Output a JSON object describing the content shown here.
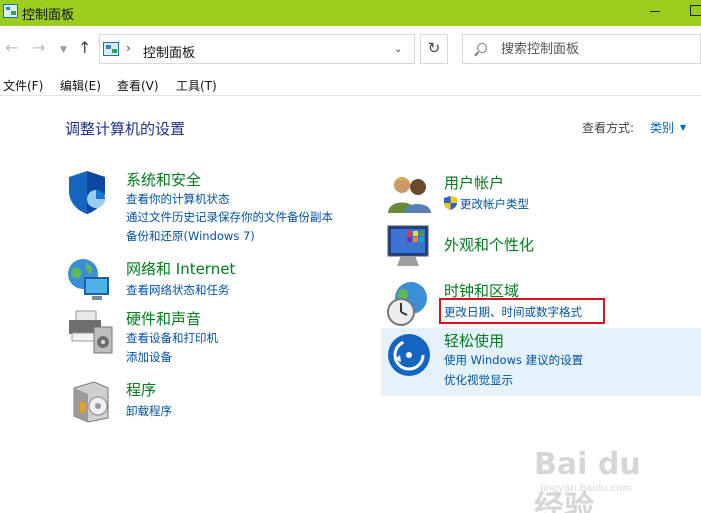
{
  "window": {
    "title": "控制面板"
  },
  "navbar": {
    "address_path": "控制面板",
    "search_placeholder": "搜索控制面板"
  },
  "menu": [
    {
      "label": "文件(F)"
    },
    {
      "label": "编辑(E)"
    },
    {
      "label": "查看(V)"
    },
    {
      "label": "工具(T)"
    }
  ],
  "main": {
    "title": "调整计算机的设置",
    "view_label": "查看方式:",
    "view_value": "类别"
  },
  "categories": {
    "system_security": {
      "title": "系统和安全",
      "links": [
        "查看你的计算机状态",
        "通过文件历史记录保存你的文件备份副本",
        "备份和还原(Windows 7)"
      ]
    },
    "network": {
      "title": "网络和 Internet",
      "links": [
        "查看网络状态和任务"
      ]
    },
    "hardware": {
      "title": "硬件和声音",
      "links": [
        "查看设备和打印机",
        "添加设备"
      ]
    },
    "programs": {
      "title": "程序",
      "links": [
        "卸载程序"
      ]
    },
    "user_accounts": {
      "title": "用户帐户",
      "links": [
        "更改帐户类型"
      ]
    },
    "appearance": {
      "title": "外观和个性化",
      "links": []
    },
    "clock_region": {
      "title": "时钟和区域",
      "links": [
        "更改日期、时间或数字格式"
      ]
    },
    "ease_of_access": {
      "title": "轻松使用",
      "links": [
        "使用 Windows 建议的设置",
        "优化视觉显示"
      ]
    }
  },
  "watermark": {
    "logo": "Bai du 经验",
    "sub": "jingyan.baidu.com"
  },
  "colors": {
    "titlebar": "#9acd1e",
    "heading_green": "#007b1e",
    "link_blue": "#0052a3",
    "highlight": "#e5f1fb",
    "annotation_red": "#d8121c"
  }
}
